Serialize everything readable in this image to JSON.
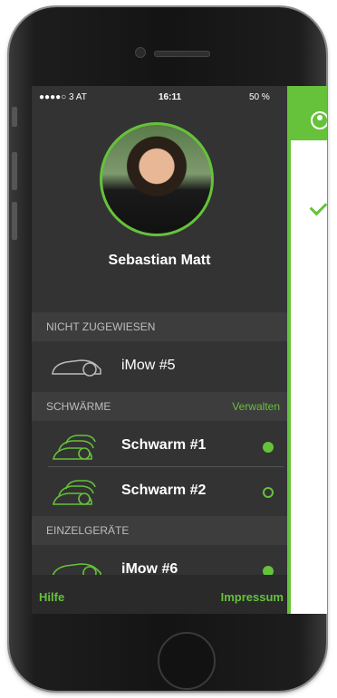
{
  "status_bar": {
    "carrier": "●●●●○ 3 AT",
    "time": "16:11",
    "battery": "50 %"
  },
  "profile": {
    "name": "Sebastian Matt"
  },
  "sections": {
    "unassigned": {
      "title": "NICHT ZUGEWIESEN",
      "items": [
        {
          "label": "iMow #5"
        }
      ]
    },
    "swarms": {
      "title": "SCHWÄRME",
      "manage_label": "Verwalten",
      "items": [
        {
          "label": "Schwarm #1",
          "status": "filled"
        },
        {
          "label": "Schwarm #2",
          "status": "empty"
        }
      ]
    },
    "single_devices": {
      "title": "EINZELGERÄTE",
      "items": [
        {
          "label": "iMow #6",
          "status": "filled"
        }
      ]
    }
  },
  "footer": {
    "help": "Hilfe",
    "imprint": "Impressum"
  },
  "colors": {
    "accent": "#65c23a",
    "drawer_bg": "#333333"
  },
  "icons": {
    "mower": "mower-icon",
    "swarm": "swarm-icon",
    "profile": "profile-icon"
  }
}
